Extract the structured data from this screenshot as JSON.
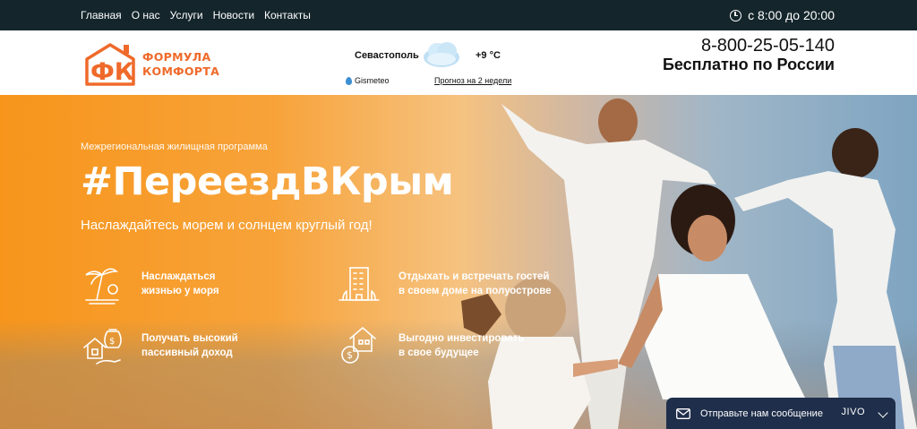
{
  "topbar": {
    "nav": [
      "Главная",
      "О нас",
      "Услуги",
      "Новости",
      "Контакты"
    ],
    "hours": "с 8:00 до 20:00"
  },
  "logo": {
    "mark": "ФК",
    "line1": "ФОРМУЛА",
    "line2": "КОМФОРТА"
  },
  "weather": {
    "city": "Севастополь",
    "temp": "+9 °C",
    "provider": "Gismeteo",
    "forecast_link": "Прогноз на 2 недели"
  },
  "contact": {
    "phone": "8-800-25-05-140",
    "subtitle": "Бесплатно по России"
  },
  "hero": {
    "eyebrow": "Межрегиональная жилищная программа",
    "hashtag": "#ПереездВКрым",
    "tagline": "Наслаждайтесь морем и солнцем круглый год!",
    "features": [
      {
        "icon": "palm-sunset-icon",
        "line1": "Наслаждаться",
        "line2": "жизнью у моря"
      },
      {
        "icon": "building-icon",
        "line1": "Отдыхать и встречать гостей",
        "line2": "в своем доме на полуострове"
      },
      {
        "icon": "house-money-icon",
        "line1": "Получать высокий",
        "line2": "пассивный доход"
      },
      {
        "icon": "invest-house-icon",
        "line1": "Выгодно инвестировать",
        "line2": "в свое будущее"
      }
    ]
  },
  "chat": {
    "label": "Отправьте нам сообщение",
    "brand": "JIVO"
  },
  "colors": {
    "topbar": "#14262c",
    "brand_orange": "#ef6a2a",
    "hero_orange": "#f7951b",
    "chat_bg": "#1f2e4a"
  }
}
